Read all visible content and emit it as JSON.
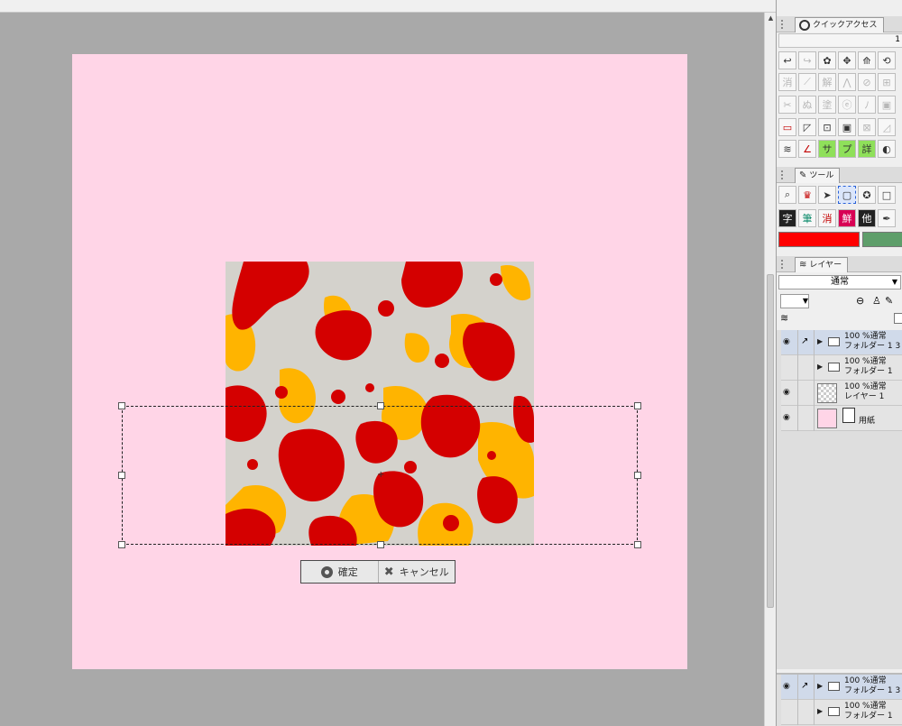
{
  "colors": {
    "paper": "#ffd5e7",
    "camo_red": "#d40000",
    "camo_yellow": "#ffb400",
    "camo_gray": "#d4d2cc",
    "main_color": "#ff0000",
    "sub_color": "#5e9e6a"
  },
  "confirm_bar": {
    "ok_label": "確定",
    "cancel_label": "キャンセル",
    "ok_icon": "circle-icon",
    "cancel_icon": "x-icon"
  },
  "panels": {
    "quick_access": {
      "tab_label": "クイックアクセス",
      "page_number": "1"
    },
    "tool": {
      "tab_label": "ツール"
    },
    "layer": {
      "tab_label": "レイヤー",
      "blend_mode": "通常"
    }
  },
  "layers": [
    {
      "name": "フォルダー 1 3",
      "opacity_mode": "100 %通常",
      "type": "folder",
      "visible": true
    },
    {
      "name": "フォルダー 1",
      "opacity_mode": "100 %通常",
      "type": "folder",
      "visible": false
    },
    {
      "name": "レイヤー 1",
      "opacity_mode": "100 %通常",
      "type": "raster",
      "visible": true
    },
    {
      "name": "用紙",
      "opacity_mode": "",
      "type": "paper",
      "visible": true
    }
  ],
  "layers_lower": [
    {
      "name": "フォルダー 1 3",
      "opacity_mode": "100 %通常"
    },
    {
      "name": "フォルダー 1",
      "opacity_mode": "100 %通常"
    }
  ]
}
